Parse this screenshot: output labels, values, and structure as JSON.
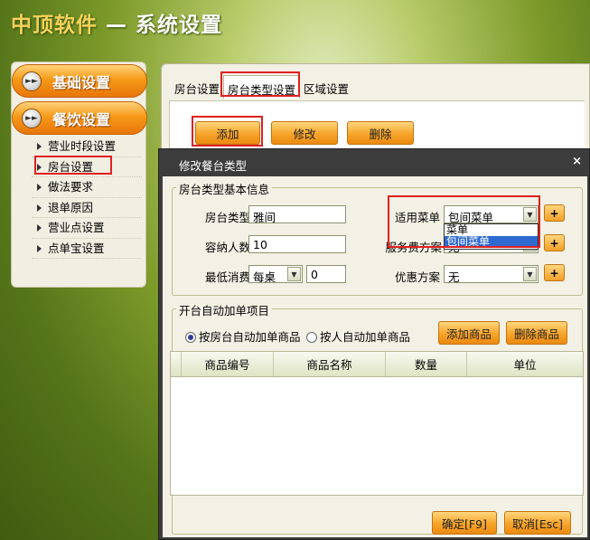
{
  "app": {
    "brand": "中顶软件",
    "title_suffix": " — 系统设置"
  },
  "nav": {
    "basic_label": "基础设置",
    "dining_label": "餐饮设置",
    "items": [
      {
        "label": "营业时段设置"
      },
      {
        "label": "房台设置"
      },
      {
        "label": "做法要求"
      },
      {
        "label": "退单原因"
      },
      {
        "label": "营业点设置"
      },
      {
        "label": "点单宝设置"
      }
    ]
  },
  "tabs": [
    {
      "label": "房台设置"
    },
    {
      "label": "房台类型设置"
    },
    {
      "label": "区域设置"
    }
  ],
  "toolbar": {
    "add_label": "添加",
    "edit_label": "修改",
    "delete_label": "删除"
  },
  "dialog": {
    "title": "修改餐台类型",
    "close_glyph": "×",
    "basic_section": "房台类型基本信息",
    "type_label": "房台类型",
    "type_value": "雅间",
    "capacity_label": "容纳人数",
    "capacity_value": "10",
    "min_spend_label": "最低消费",
    "min_spend_unit": "每桌",
    "min_spend_value": "0",
    "menu_label": "适用菜单",
    "menu_value": "包间菜单",
    "menu_options": [
      "菜单",
      "包间菜单"
    ],
    "service_label": "服务费方案",
    "service_value": "无",
    "discount_label": "优惠方案",
    "discount_value": "无",
    "auto_section": "开台自动加单项目",
    "radio_by_room": "按房台自动加单商品",
    "radio_by_person": "按人自动加单商品",
    "add_goods_label": "添加商品",
    "delete_goods_label": "删除商品",
    "grid_columns": [
      "商品编号",
      "商品名称",
      "数量",
      "单位"
    ],
    "ok_label": "确定[F9]",
    "cancel_label": "取消[Esc]"
  }
}
